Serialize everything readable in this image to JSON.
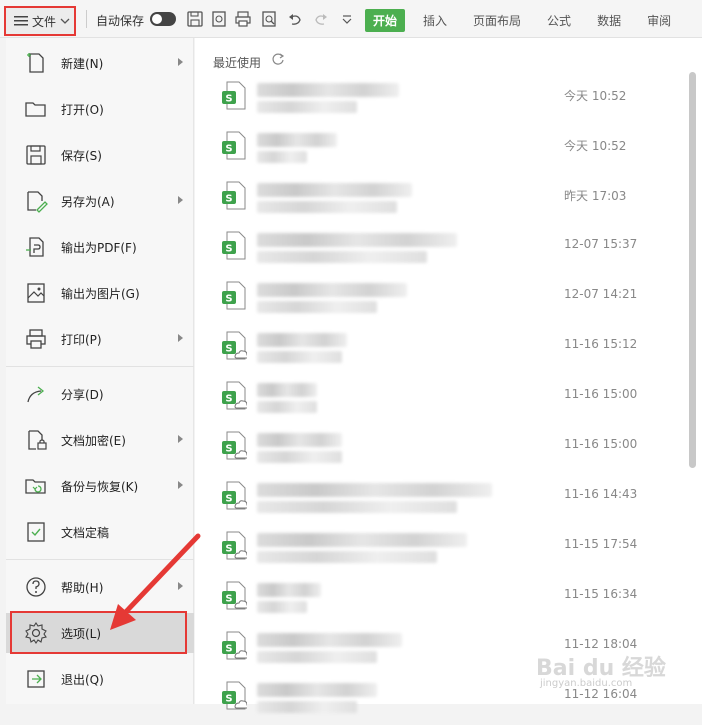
{
  "toolbar": {
    "file_label": "文件",
    "autosave_label": "自动保存",
    "tabs": [
      {
        "label": "开始",
        "active": true
      },
      {
        "label": "插入"
      },
      {
        "label": "页面布局"
      },
      {
        "label": "公式"
      },
      {
        "label": "数据"
      },
      {
        "label": "审阅"
      }
    ]
  },
  "menu": {
    "items": [
      {
        "label": "新建(N)",
        "icon": "new-file-icon",
        "submenu": true
      },
      {
        "label": "打开(O)",
        "icon": "folder-open-icon",
        "submenu": false
      },
      {
        "label": "保存(S)",
        "icon": "save-icon",
        "submenu": false
      },
      {
        "label": "另存为(A)",
        "icon": "save-as-icon",
        "submenu": true
      },
      {
        "label": "输出为PDF(F)",
        "icon": "pdf-export-icon",
        "submenu": false
      },
      {
        "label": "输出为图片(G)",
        "icon": "image-export-icon",
        "submenu": false
      },
      {
        "label": "打印(P)",
        "icon": "printer-icon",
        "submenu": true
      },
      {
        "label": "分享(D)",
        "icon": "share-icon",
        "submenu": false
      },
      {
        "label": "文档加密(E)",
        "icon": "encrypt-doc-icon",
        "submenu": true
      },
      {
        "label": "备份与恢复(K)",
        "icon": "backup-restore-icon",
        "submenu": true
      },
      {
        "label": "文档定稿",
        "icon": "finalize-doc-icon",
        "submenu": false
      },
      {
        "label": "帮助(H)",
        "icon": "help-icon",
        "submenu": true
      },
      {
        "label": "选项(L)",
        "icon": "gear-icon",
        "submenu": false,
        "selected": true
      },
      {
        "label": "退出(Q)",
        "icon": "exit-icon",
        "submenu": false
      }
    ]
  },
  "recent": {
    "title": "最近使用",
    "files": [
      {
        "time": "今天  10:52",
        "cloud": false
      },
      {
        "time": "今天  10:52",
        "cloud": false
      },
      {
        "time": "昨天  17:03",
        "cloud": false
      },
      {
        "time": "12-07 15:37",
        "cloud": false
      },
      {
        "time": "12-07 14:21",
        "cloud": false
      },
      {
        "time": "11-16 15:12",
        "cloud": true
      },
      {
        "time": "11-16 15:00",
        "cloud": true
      },
      {
        "time": "11-16 15:00",
        "cloud": true
      },
      {
        "time": "11-16 14:43",
        "cloud": true
      },
      {
        "time": "11-15 17:54",
        "cloud": true
      },
      {
        "time": "11-15 16:34",
        "cloud": true
      },
      {
        "time": "11-12 18:04",
        "cloud": true
      },
      {
        "time": "11-12 16:04",
        "cloud": true
      }
    ]
  },
  "watermark": {
    "text": "Bai du 经验",
    "subtext": "jingyan.baidu.com"
  },
  "colors": {
    "accent": "#4caf50",
    "annotation": "#e53935"
  }
}
